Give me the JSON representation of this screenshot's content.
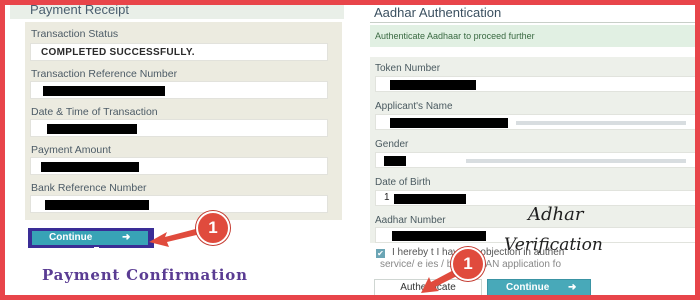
{
  "receipt": {
    "title": "Payment Receipt",
    "fields": [
      {
        "label": "Transaction Status",
        "value": "COMPLETED SUCCESSFULLY."
      },
      {
        "label": "Transaction Reference Number",
        "value": ""
      },
      {
        "label": "Date & Time of Transaction",
        "value": ""
      },
      {
        "label": "Payment Amount",
        "value": ""
      },
      {
        "label": "Bank Reference Number",
        "value": ""
      }
    ],
    "continue_label": "Continue",
    "continue_arrow": "➜",
    "caption": "Payment Confirmation"
  },
  "badges": {
    "left": "1",
    "right": "1"
  },
  "aadhar": {
    "title": "Aadhar Authentication",
    "hint": "Authenticate Aadhaar to proceed further",
    "fields": [
      {
        "label": "Token Number"
      },
      {
        "label": "Applicant's Name"
      },
      {
        "label": "Gender"
      },
      {
        "label": "Date of Birth",
        "value_prefix": "1"
      },
      {
        "label": "Aadhar Number"
      }
    ],
    "consent_line1": "I hereby          t I have no objection in authen",
    "consent_line2": "service/ e        ies / both in PAN application fo",
    "check_mark": "✔",
    "authenticate_label": "Authenticate",
    "continue_label": "Continue",
    "continue_arrow": "➜",
    "annotation_line1": "Adhar",
    "annotation_line2": "Verification"
  },
  "colors": {
    "frame": "#e8454a",
    "button_teal": "#38a3b6",
    "highlight": "#3a2d96",
    "badge": "#e04b3d",
    "caption": "#5a3c93"
  }
}
